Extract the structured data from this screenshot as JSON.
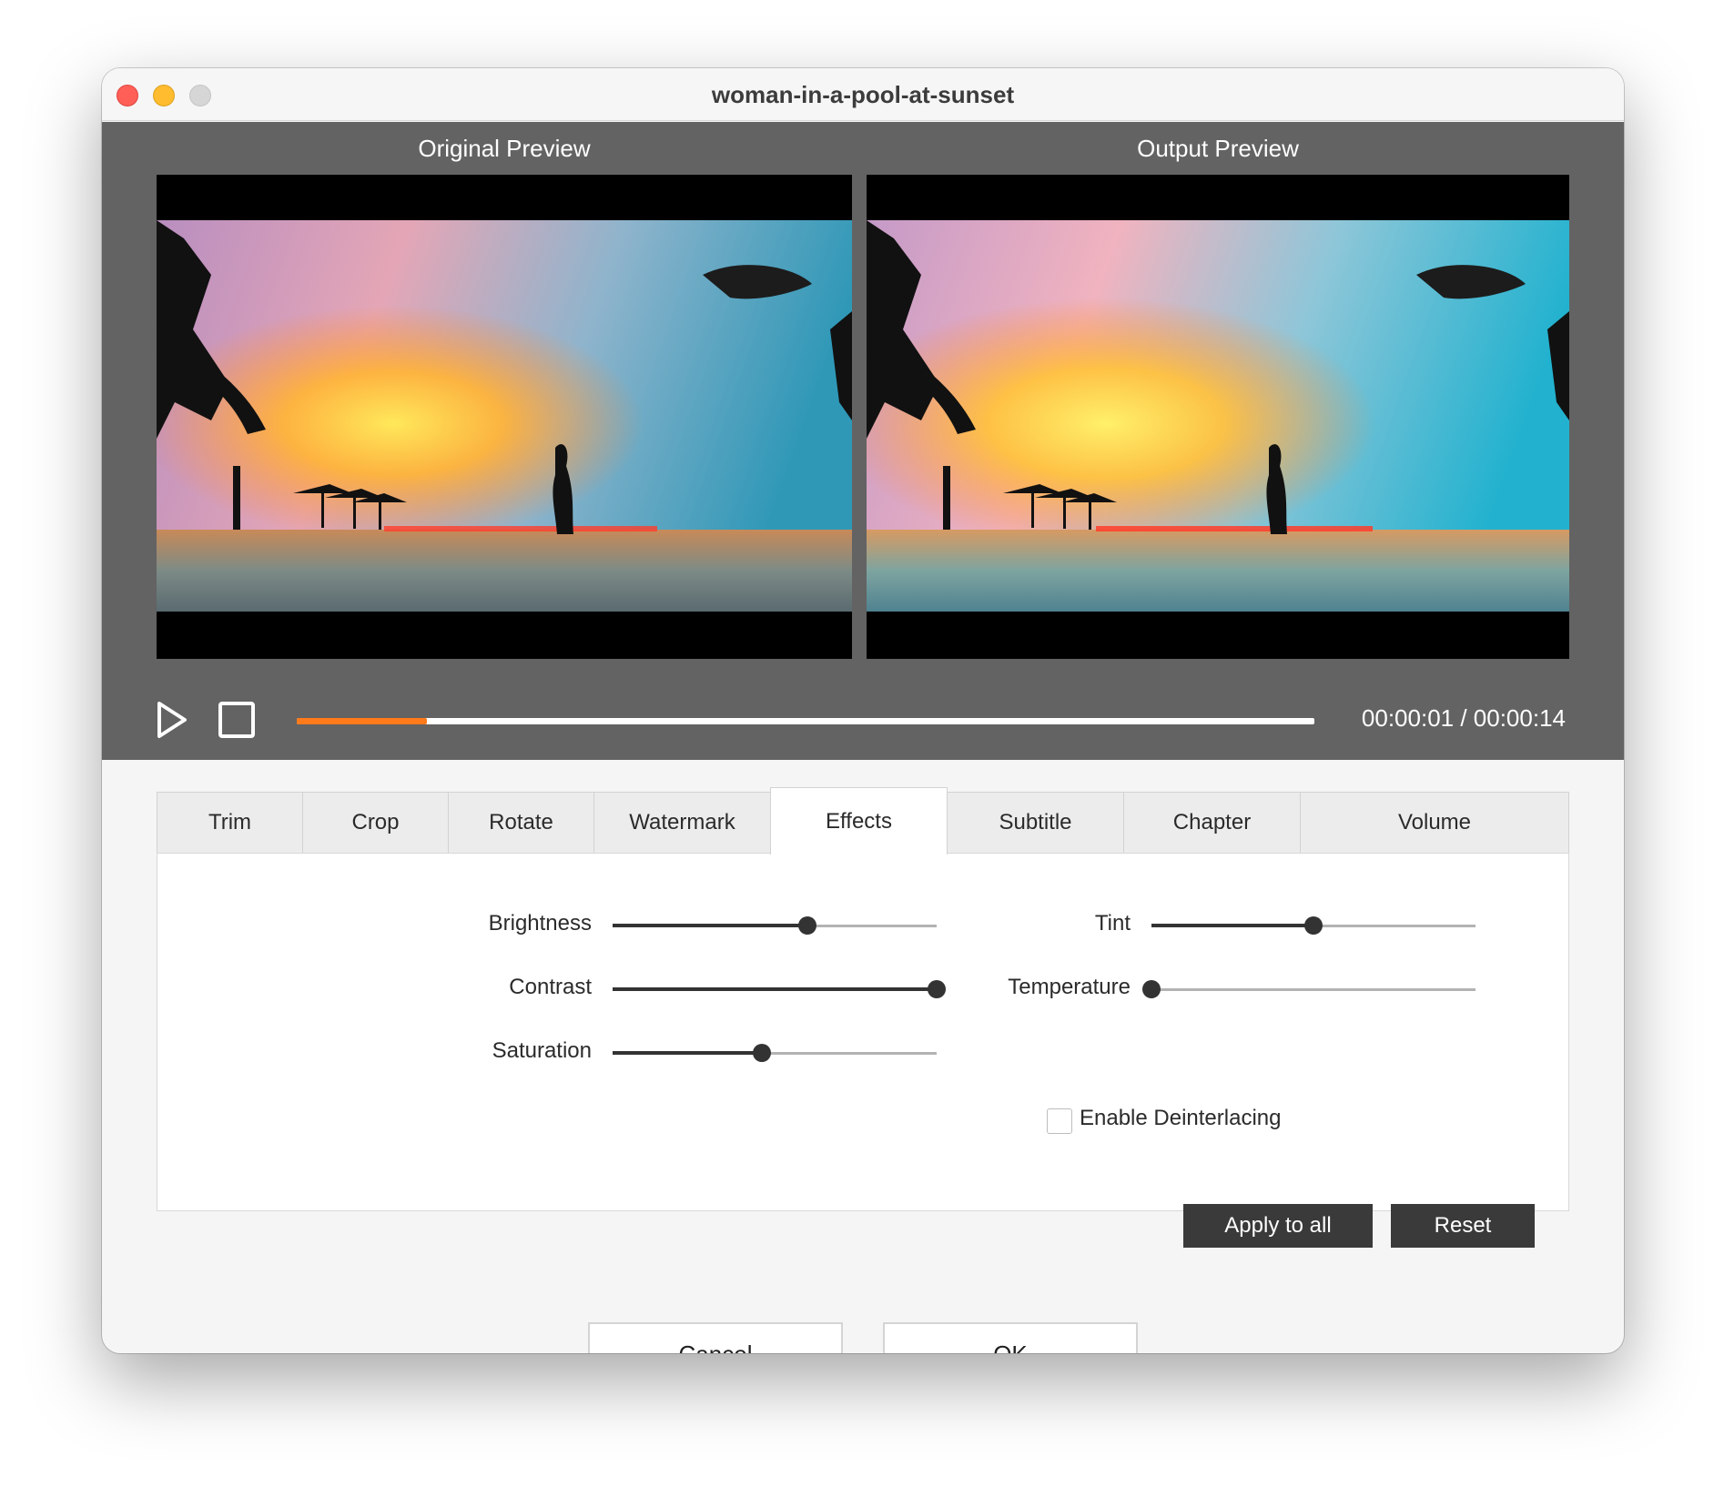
{
  "window": {
    "title": "woman-in-a-pool-at-sunset"
  },
  "preview": {
    "original_label": "Original Preview",
    "output_label": "Output Preview",
    "original_icon": "video-frame-sunset",
    "output_icon": "video-frame-sunset"
  },
  "playback": {
    "play_icon": "play-icon",
    "stop_icon": "stop-icon",
    "progress": 0.128,
    "time": "00:00:01 / 00:00:14",
    "progress_color": "#ff7a1a"
  },
  "tabs": [
    {
      "label": "Trim",
      "active": false
    },
    {
      "label": "Crop",
      "active": false
    },
    {
      "label": "Rotate",
      "active": false
    },
    {
      "label": "Watermark",
      "active": false
    },
    {
      "label": "Effects",
      "active": true
    },
    {
      "label": "Subtitle",
      "active": false
    },
    {
      "label": "Chapter",
      "active": false
    },
    {
      "label": "Volume",
      "active": false
    }
  ],
  "effects": {
    "brightness": {
      "label": "Brightness",
      "value": 0.6
    },
    "contrast": {
      "label": "Contrast",
      "value": 1.0
    },
    "saturation": {
      "label": "Saturation",
      "value": 0.46
    },
    "tint": {
      "label": "Tint",
      "value": 0.5
    },
    "temperature": {
      "label": "Temperature",
      "value": 0.0
    },
    "deinterlacing": {
      "label": "Enable Deinterlacing",
      "checked": false
    },
    "apply_all_label": "Apply to all",
    "reset_label": "Reset"
  },
  "footer": {
    "cancel_label": "Cancel",
    "ok_label": "OK"
  },
  "colors": {
    "preview_bg": "#636363",
    "dark_button": "#3a3a3a",
    "close": "#ff5f57",
    "minimize": "#febc2e",
    "zoom": "#d6d6d6"
  }
}
